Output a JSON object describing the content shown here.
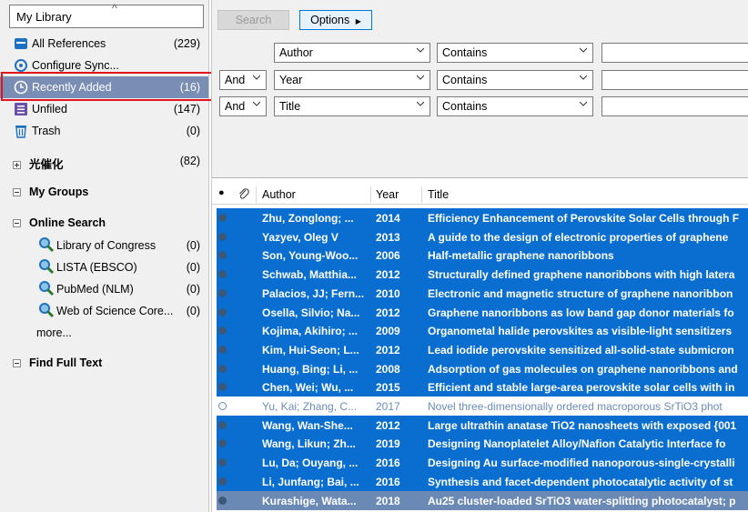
{
  "library_selector": {
    "label": "My Library"
  },
  "sidebar": {
    "items": [
      {
        "label": "All References",
        "count": "(229)"
      },
      {
        "label": "Configure Sync...",
        "count": ""
      },
      {
        "label": "Recently Added",
        "count": "(16)"
      },
      {
        "label": "Unfiled",
        "count": "(147)"
      },
      {
        "label": "Trash",
        "count": "(0)"
      }
    ],
    "group_photocatalysis": {
      "label": "光催化",
      "count": "(82)"
    },
    "my_groups": {
      "label": "My Groups"
    },
    "online_search": {
      "label": "Online Search",
      "items": [
        {
          "label": "Library of Congress",
          "count": "(0)"
        },
        {
          "label": "LISTA (EBSCO)",
          "count": "(0)"
        },
        {
          "label": "PubMed (NLM)",
          "count": "(0)"
        },
        {
          "label": "Web of Science Core...",
          "count": "(0)"
        }
      ],
      "more": "more..."
    },
    "find_full_text": {
      "label": "Find Full Text"
    }
  },
  "search": {
    "search_label": "Search",
    "options_label": "Options",
    "rows": [
      {
        "bool": "",
        "field": "Author",
        "op": "Contains"
      },
      {
        "bool": "And",
        "field": "Year",
        "op": "Contains"
      },
      {
        "bool": "And",
        "field": "Title",
        "op": "Contains"
      }
    ]
  },
  "table": {
    "headers": {
      "author": "Author",
      "year": "Year",
      "title": "Title"
    },
    "rows": [
      {
        "author": "Zhu, Zonglong; ...",
        "year": "2014",
        "title": "Efficiency Enhancement of Perovskite Solar Cells through F",
        "read": true
      },
      {
        "author": "Yazyev, Oleg V",
        "year": "2013",
        "title": "A guide to the design of electronic properties of graphene",
        "read": true
      },
      {
        "author": "Son, Young-Woo...",
        "year": "2006",
        "title": "Half-metallic graphene nanoribbons",
        "read": true
      },
      {
        "author": "Schwab, Matthia...",
        "year": "2012",
        "title": "Structurally defined graphene nanoribbons with high latera",
        "read": true
      },
      {
        "author": "Palacios, JJ; Fern...",
        "year": "2010",
        "title": "Electronic and magnetic structure of graphene nanoribbon",
        "read": true
      },
      {
        "author": "Osella, Silvio; Na...",
        "year": "2012",
        "title": "Graphene nanoribbons as low band gap donor materials fo",
        "read": true
      },
      {
        "author": "Kojima, Akihiro; ...",
        "year": "2009",
        "title": "Organometal halide perovskites as visible-light sensitizers",
        "read": true
      },
      {
        "author": "Kim, Hui-Seon; L...",
        "year": "2012",
        "title": "Lead iodide perovskite sensitized all-solid-state submicron",
        "read": true
      },
      {
        "author": "Huang, Bing; Li, ...",
        "year": "2008",
        "title": "Adsorption of gas molecules on graphene nanoribbons and",
        "read": true
      },
      {
        "author": "Chen, Wei; Wu, ...",
        "year": "2015",
        "title": "Efficient and stable large-area perovskite solar cells with in",
        "read": true
      },
      {
        "author": "Yu, Kai; Zhang, C...",
        "year": "2017",
        "title": "Novel three-dimensionally ordered macroporous SrTiO3 phot",
        "read": false
      },
      {
        "author": "Wang, Wan-She...",
        "year": "2012",
        "title": "Large ultrathin anatase TiO2 nanosheets with exposed {001",
        "read": true
      },
      {
        "author": "Wang, Likun; Zh...",
        "year": "2019",
        "title": "Designing Nanoplatelet Alloy/Nafion Catalytic Interface fo",
        "read": true
      },
      {
        "author": "Lu, Da; Ouyang, ...",
        "year": "2016",
        "title": "Designing Au surface-modified nanoporous-single-crystalli",
        "read": true
      },
      {
        "author": "Li, Junfang; Bai, ...",
        "year": "2016",
        "title": "Synthesis and facet-dependent photocatalytic activity of st",
        "read": true
      },
      {
        "author": "Kurashige, Wata...",
        "year": "2018",
        "title": "Au25 cluster-loaded SrTiO3 water-splitting photocatalyst; p",
        "read": true
      }
    ]
  },
  "colors": {
    "selection": "#0a6ed1",
    "sidebar_selected": "#7a8db4",
    "highlight_box": "#e0151e"
  }
}
